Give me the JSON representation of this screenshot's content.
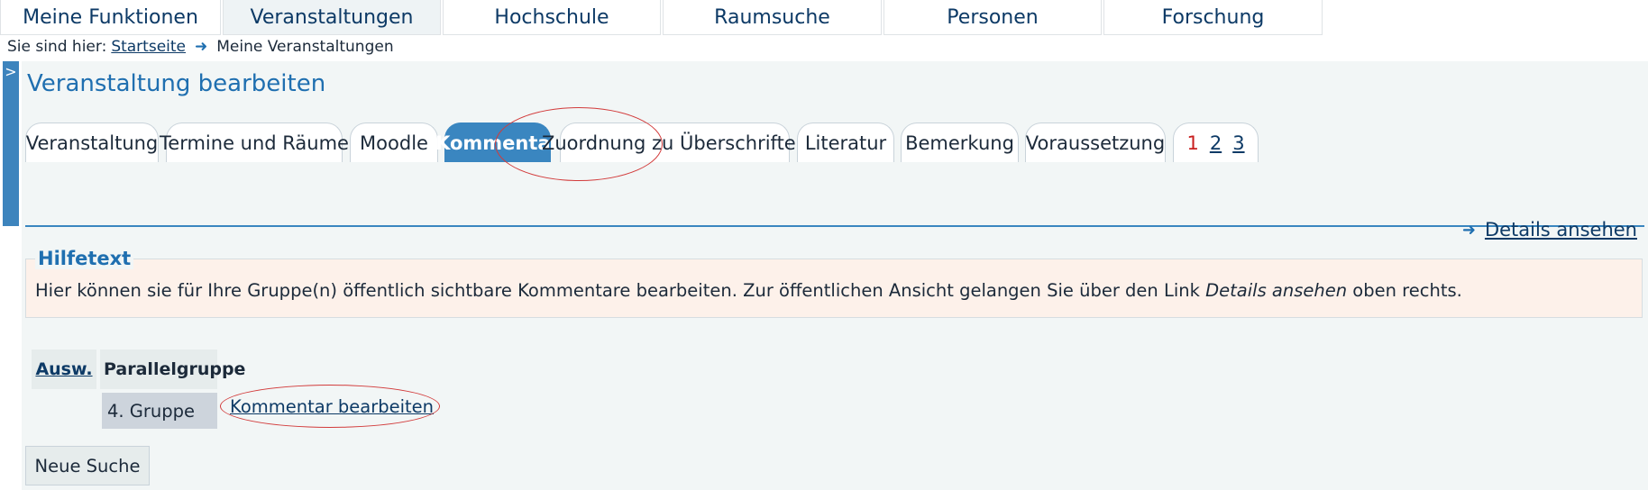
{
  "topnav": {
    "items": [
      {
        "label": "Meine Funktionen"
      },
      {
        "label": "Veranstaltungen"
      },
      {
        "label": "Hochschule"
      },
      {
        "label": "Raumsuche"
      },
      {
        "label": "Personen"
      },
      {
        "label": "Forschung"
      }
    ],
    "active": "Veranstaltungen"
  },
  "breadcrumb": {
    "prefix": "Sie sind hier:",
    "home": "Startseite",
    "current": "Meine Veranstaltungen"
  },
  "side_toggle": ">",
  "page": {
    "title": "Veranstaltung bearbeiten"
  },
  "tabs": {
    "items": [
      {
        "label": "Veranstaltung"
      },
      {
        "label": "Termine und Räume"
      },
      {
        "label": "Moodle"
      },
      {
        "label": "Kommentar"
      },
      {
        "label": "Zuordnung zu Überschriften"
      },
      {
        "label": "Literatur"
      },
      {
        "label": "Bemerkung"
      },
      {
        "label": "Voraussetzung"
      }
    ],
    "active": "Kommentar",
    "pages": [
      "1",
      "2",
      "3"
    ],
    "current_page": "1"
  },
  "details_link": "Details ansehen",
  "help": {
    "legend": "Hilfetext",
    "text_before": "Hier können sie für Ihre Gruppe(n) öffentlich sichtbare Kommentare bearbeiten. Zur öffentlichen Ansicht gelangen Sie über den Link ",
    "text_italic": "Details ansehen",
    "text_after": " oben rechts."
  },
  "table": {
    "headers": [
      "Ausw.",
      "Parallelgruppe"
    ],
    "rows": [
      {
        "group": "4. Gruppe",
        "action": "Kommentar bearbeiten"
      }
    ]
  },
  "buttons": {
    "new_search": "Neue Suche"
  },
  "colors": {
    "accent": "#3a86c0",
    "title": "#1f6fb0",
    "help_bg": "#fdf1ea",
    "annotation": "#d23b3b"
  }
}
